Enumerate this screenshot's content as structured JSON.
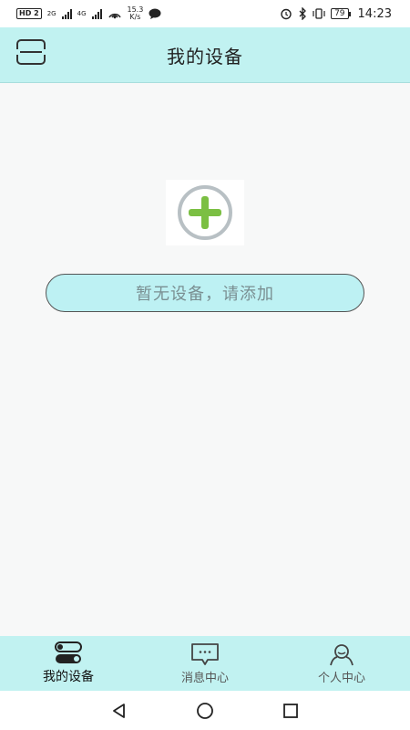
{
  "status_bar": {
    "hd_badge": "HD",
    "hd_sub": "2",
    "net1": "2G",
    "net2": "4G",
    "speed_value": "15.3",
    "speed_unit": "K/s",
    "battery": "79",
    "time": "14:23"
  },
  "header": {
    "title": "我的设备",
    "menu_icon": "list-toggle-icon"
  },
  "main": {
    "add_icon": "plus-circle-icon",
    "empty_message": "暂无设备，请添加",
    "accent_color": "#7bbf43"
  },
  "bottom_nav": {
    "items": [
      {
        "label": "我的设备",
        "icon": "toggle-switches-icon",
        "active": true
      },
      {
        "label": "消息中心",
        "icon": "chat-bubble-icon",
        "active": false
      },
      {
        "label": "个人中心",
        "icon": "person-icon",
        "active": false
      }
    ]
  },
  "system_nav": {
    "back_icon": "back-triangle-icon",
    "home_icon": "home-circle-icon",
    "recents_icon": "recents-square-icon"
  }
}
